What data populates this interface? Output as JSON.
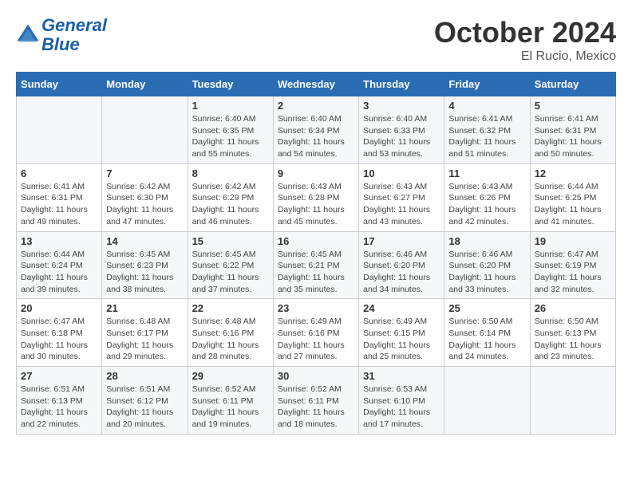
{
  "header": {
    "logo_line1": "General",
    "logo_line2": "Blue",
    "month": "October 2024",
    "location": "El Rucio, Mexico"
  },
  "weekdays": [
    "Sunday",
    "Monday",
    "Tuesday",
    "Wednesday",
    "Thursday",
    "Friday",
    "Saturday"
  ],
  "weeks": [
    [
      {
        "day": "",
        "info": ""
      },
      {
        "day": "",
        "info": ""
      },
      {
        "day": "1",
        "info": "Sunrise: 6:40 AM\nSunset: 6:35 PM\nDaylight: 11 hours and 55 minutes."
      },
      {
        "day": "2",
        "info": "Sunrise: 6:40 AM\nSunset: 6:34 PM\nDaylight: 11 hours and 54 minutes."
      },
      {
        "day": "3",
        "info": "Sunrise: 6:40 AM\nSunset: 6:33 PM\nDaylight: 11 hours and 53 minutes."
      },
      {
        "day": "4",
        "info": "Sunrise: 6:41 AM\nSunset: 6:32 PM\nDaylight: 11 hours and 51 minutes."
      },
      {
        "day": "5",
        "info": "Sunrise: 6:41 AM\nSunset: 6:31 PM\nDaylight: 11 hours and 50 minutes."
      }
    ],
    [
      {
        "day": "6",
        "info": "Sunrise: 6:41 AM\nSunset: 6:31 PM\nDaylight: 11 hours and 49 minutes."
      },
      {
        "day": "7",
        "info": "Sunrise: 6:42 AM\nSunset: 6:30 PM\nDaylight: 11 hours and 47 minutes."
      },
      {
        "day": "8",
        "info": "Sunrise: 6:42 AM\nSunset: 6:29 PM\nDaylight: 11 hours and 46 minutes."
      },
      {
        "day": "9",
        "info": "Sunrise: 6:43 AM\nSunset: 6:28 PM\nDaylight: 11 hours and 45 minutes."
      },
      {
        "day": "10",
        "info": "Sunrise: 6:43 AM\nSunset: 6:27 PM\nDaylight: 11 hours and 43 minutes."
      },
      {
        "day": "11",
        "info": "Sunrise: 6:43 AM\nSunset: 6:26 PM\nDaylight: 11 hours and 42 minutes."
      },
      {
        "day": "12",
        "info": "Sunrise: 6:44 AM\nSunset: 6:25 PM\nDaylight: 11 hours and 41 minutes."
      }
    ],
    [
      {
        "day": "13",
        "info": "Sunrise: 6:44 AM\nSunset: 6:24 PM\nDaylight: 11 hours and 39 minutes."
      },
      {
        "day": "14",
        "info": "Sunrise: 6:45 AM\nSunset: 6:23 PM\nDaylight: 11 hours and 38 minutes."
      },
      {
        "day": "15",
        "info": "Sunrise: 6:45 AM\nSunset: 6:22 PM\nDaylight: 11 hours and 37 minutes."
      },
      {
        "day": "16",
        "info": "Sunrise: 6:45 AM\nSunset: 6:21 PM\nDaylight: 11 hours and 35 minutes."
      },
      {
        "day": "17",
        "info": "Sunrise: 6:46 AM\nSunset: 6:20 PM\nDaylight: 11 hours and 34 minutes."
      },
      {
        "day": "18",
        "info": "Sunrise: 6:46 AM\nSunset: 6:20 PM\nDaylight: 11 hours and 33 minutes."
      },
      {
        "day": "19",
        "info": "Sunrise: 6:47 AM\nSunset: 6:19 PM\nDaylight: 11 hours and 32 minutes."
      }
    ],
    [
      {
        "day": "20",
        "info": "Sunrise: 6:47 AM\nSunset: 6:18 PM\nDaylight: 11 hours and 30 minutes."
      },
      {
        "day": "21",
        "info": "Sunrise: 6:48 AM\nSunset: 6:17 PM\nDaylight: 11 hours and 29 minutes."
      },
      {
        "day": "22",
        "info": "Sunrise: 6:48 AM\nSunset: 6:16 PM\nDaylight: 11 hours and 28 minutes."
      },
      {
        "day": "23",
        "info": "Sunrise: 6:49 AM\nSunset: 6:16 PM\nDaylight: 11 hours and 27 minutes."
      },
      {
        "day": "24",
        "info": "Sunrise: 6:49 AM\nSunset: 6:15 PM\nDaylight: 11 hours and 25 minutes."
      },
      {
        "day": "25",
        "info": "Sunrise: 6:50 AM\nSunset: 6:14 PM\nDaylight: 11 hours and 24 minutes."
      },
      {
        "day": "26",
        "info": "Sunrise: 6:50 AM\nSunset: 6:13 PM\nDaylight: 11 hours and 23 minutes."
      }
    ],
    [
      {
        "day": "27",
        "info": "Sunrise: 6:51 AM\nSunset: 6:13 PM\nDaylight: 11 hours and 22 minutes."
      },
      {
        "day": "28",
        "info": "Sunrise: 6:51 AM\nSunset: 6:12 PM\nDaylight: 11 hours and 20 minutes."
      },
      {
        "day": "29",
        "info": "Sunrise: 6:52 AM\nSunset: 6:11 PM\nDaylight: 11 hours and 19 minutes."
      },
      {
        "day": "30",
        "info": "Sunrise: 6:52 AM\nSunset: 6:11 PM\nDaylight: 11 hours and 18 minutes."
      },
      {
        "day": "31",
        "info": "Sunrise: 6:53 AM\nSunset: 6:10 PM\nDaylight: 11 hours and 17 minutes."
      },
      {
        "day": "",
        "info": ""
      },
      {
        "day": "",
        "info": ""
      }
    ]
  ]
}
